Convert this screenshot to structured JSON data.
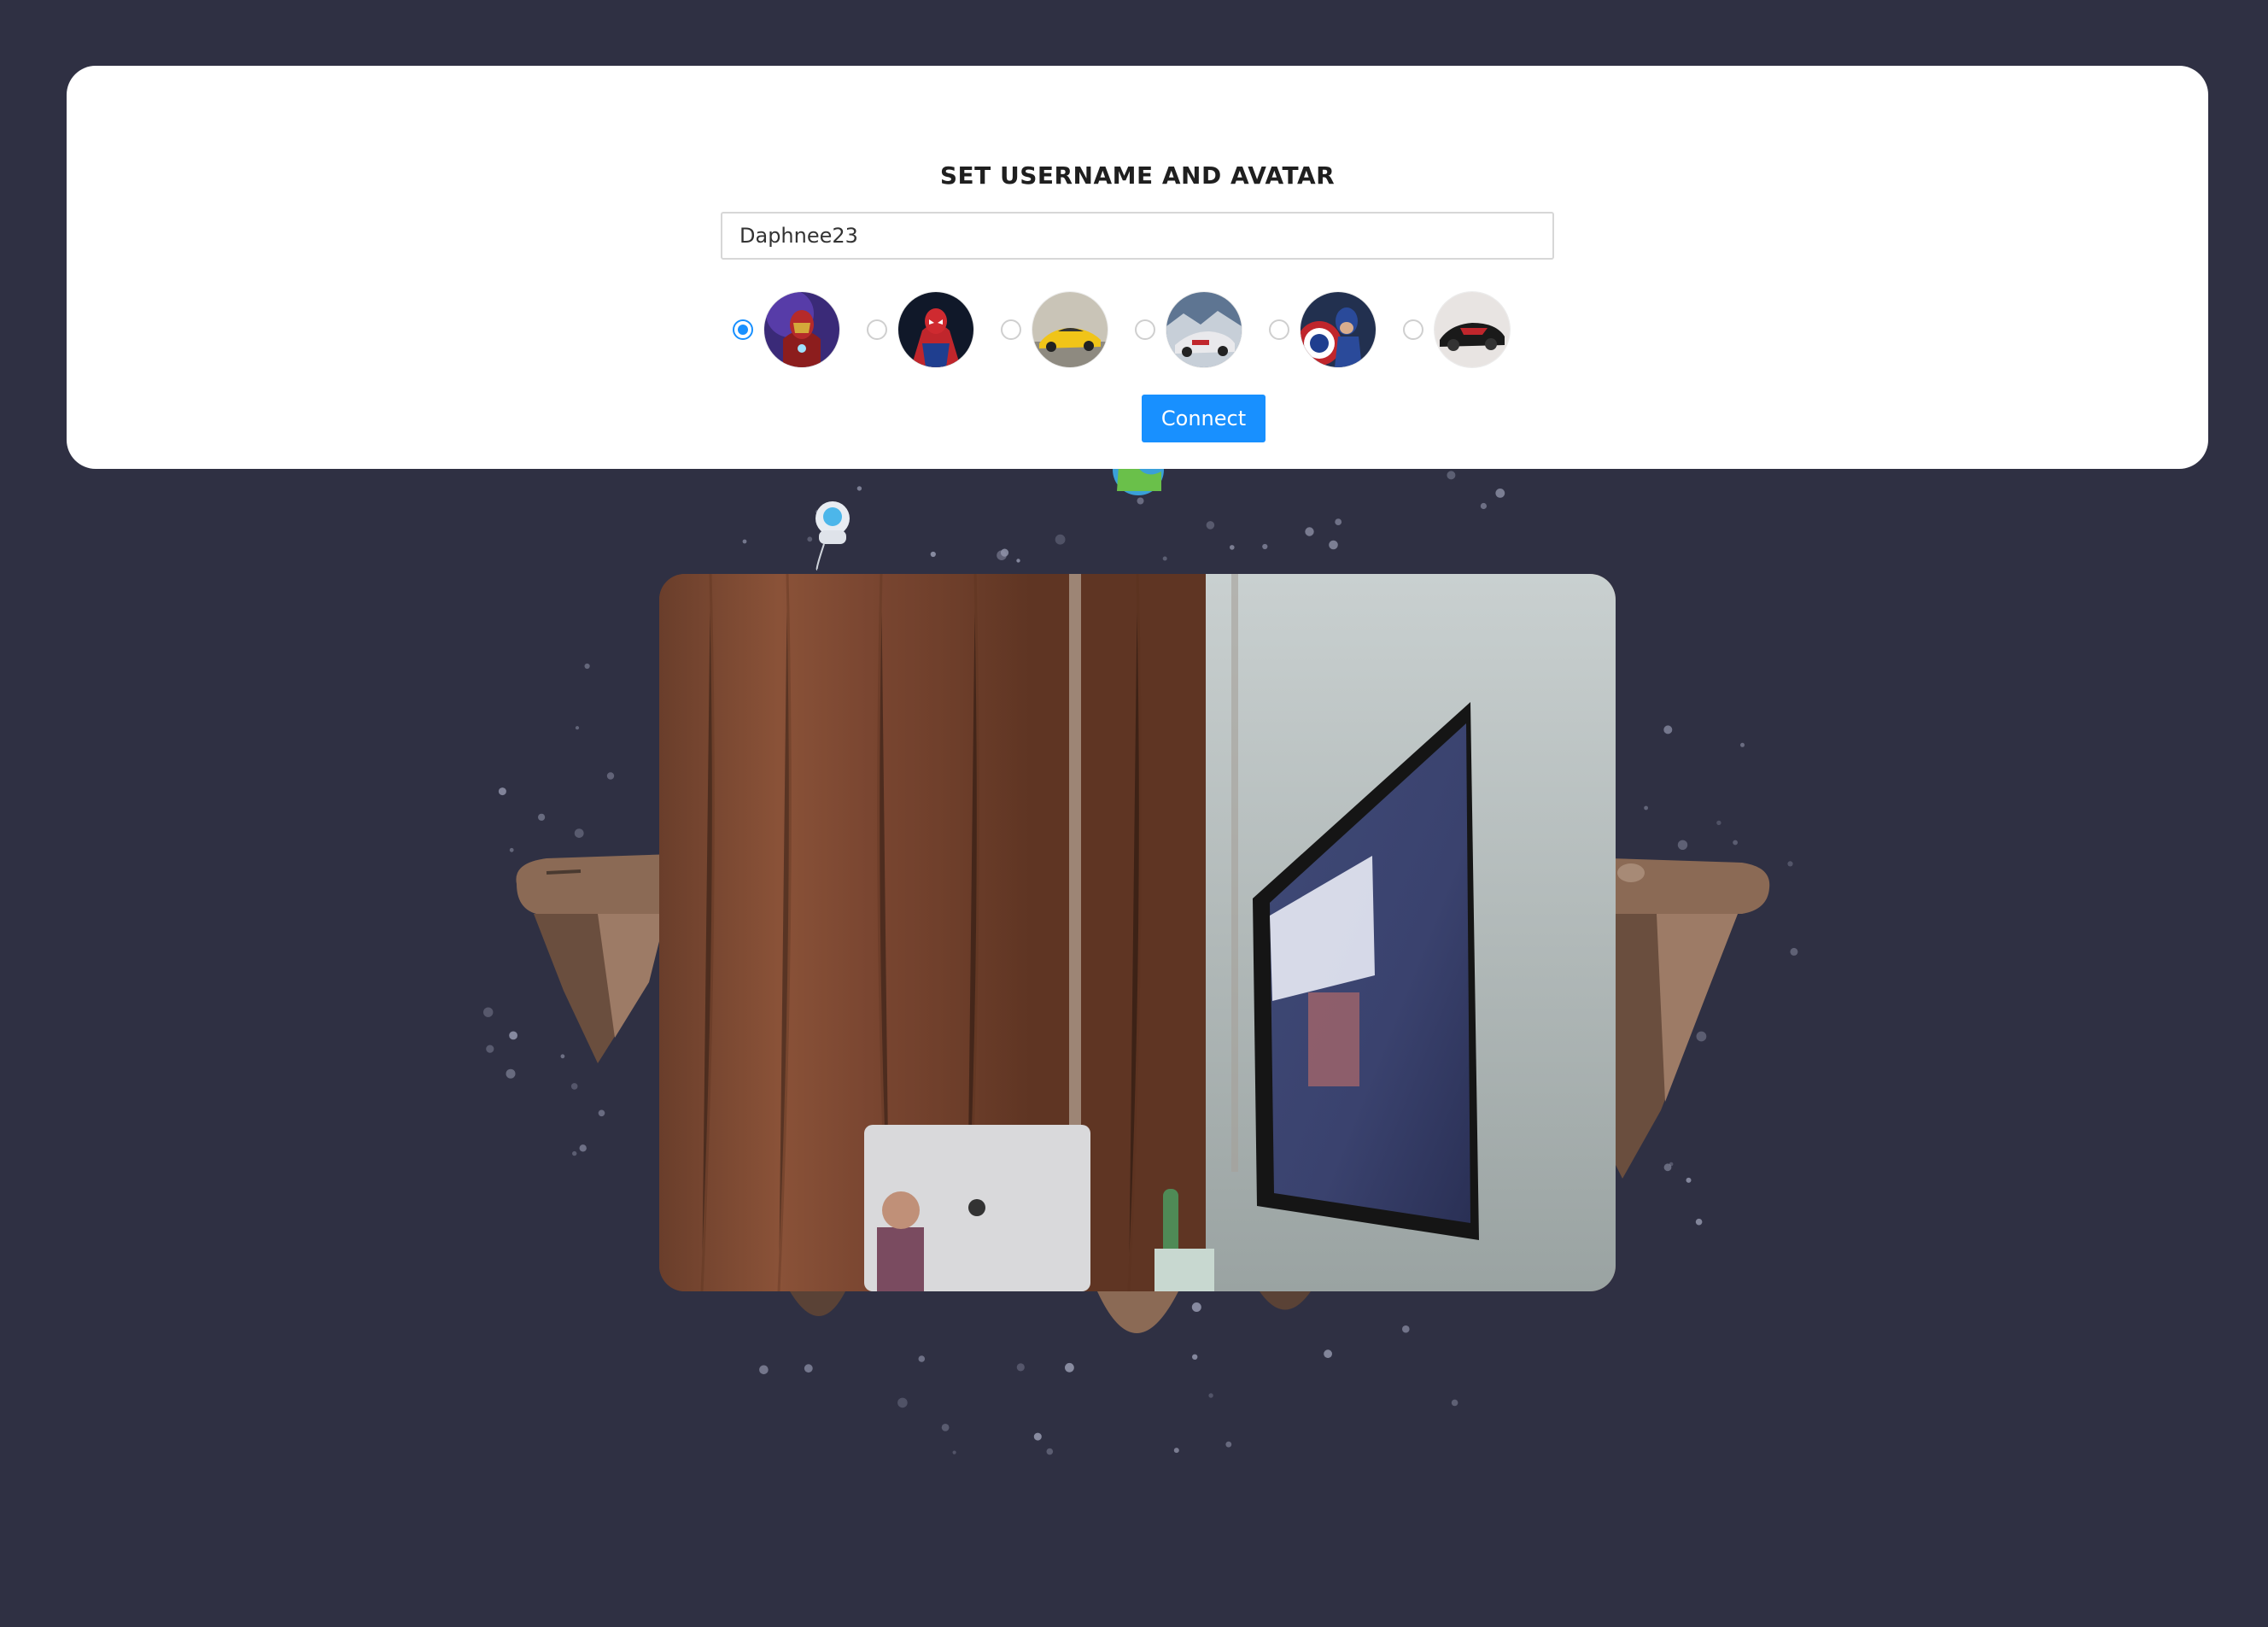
{
  "modal": {
    "title": "SET USERNAME AND AVATAR",
    "username_value": "Daphnee23",
    "connect_label": "Connect",
    "avatars": [
      {
        "name": "iron-man-avatar",
        "selected": true
      },
      {
        "name": "spider-man-avatar",
        "selected": false
      },
      {
        "name": "yellow-sports-car-avatar",
        "selected": false
      },
      {
        "name": "rally-car-avatar",
        "selected": false
      },
      {
        "name": "captain-america-avatar",
        "selected": false
      },
      {
        "name": "red-black-supercar-avatar",
        "selected": false
      }
    ]
  },
  "colors": {
    "page_background": "#2f3043",
    "accent": "#1890ff",
    "card_background": "#ffffff"
  },
  "icons": [
    "astronaut-icon",
    "planet-icon"
  ]
}
